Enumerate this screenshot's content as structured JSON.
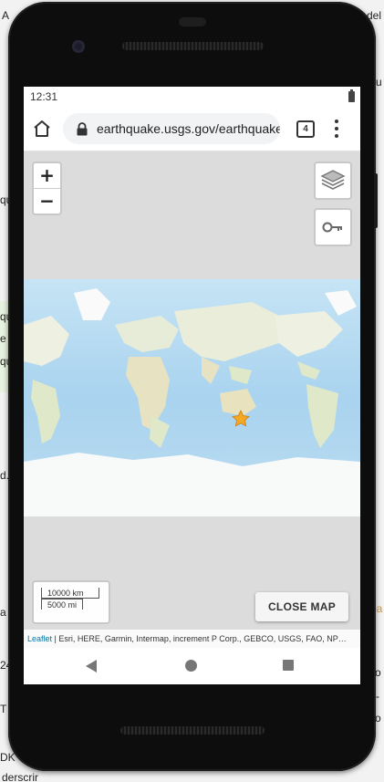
{
  "background_window": {
    "fragments": [
      "A",
      "qu",
      "qu",
      "e",
      "qu",
      "d.",
      "a",
      "24",
      "T",
      "DK",
      "derscrir",
      "del",
      "u",
      "o",
      "-",
      "o",
      "ea"
    ]
  },
  "statusbar": {
    "time": "12:31"
  },
  "browser": {
    "url": "earthquake.usgs.gov/earthquake",
    "tab_count": "4"
  },
  "map": {
    "zoom_in_label": "+",
    "zoom_out_label": "−",
    "scale_km": "10000 km",
    "scale_mi": "5000 mi",
    "close_map_label": "CLOSE MAP",
    "attribution_link": "Leaflet",
    "attribution_text": " | Esri, HERE, Garmin, Intermap, increment P Corp., GEBCO, USGS, FAO, NP…",
    "epicenter_marker_color": "#f5a623"
  },
  "icons": [
    "home-icon",
    "lock-icon",
    "tab-switcher-icon",
    "overflow-menu-icon",
    "layers-icon",
    "key-icon",
    "star-marker-icon",
    "back-icon",
    "home-nav-icon",
    "recents-icon",
    "battery-icon",
    "camera-icon"
  ]
}
